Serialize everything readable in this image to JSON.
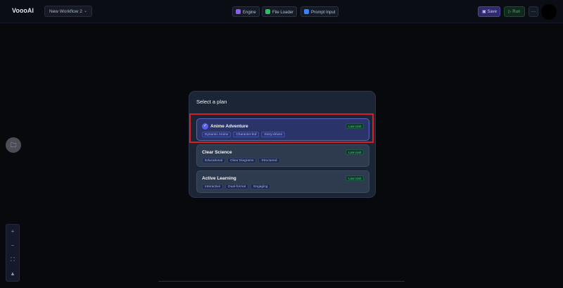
{
  "header": {
    "brand": "VoooAI",
    "workflow_name": "New Workflow 2",
    "tools": [
      {
        "label": "Engine",
        "color": "#8b5cf6"
      },
      {
        "label": "File Loader",
        "color": "#22c55e"
      },
      {
        "label": "Prompt Input",
        "color": "#3b82f6"
      }
    ],
    "save_label": "Save",
    "run_label": "Run",
    "more_label": "…"
  },
  "left_panel": {
    "folder_icon": "folder-icon",
    "zoom_icons": [
      "+",
      "−",
      "⛶",
      "▲"
    ]
  },
  "modal": {
    "title": "Select a plan",
    "plans": [
      {
        "name": "Anime Adventure",
        "cost": "Low cost",
        "selected": true,
        "tags": [
          "Dynamic Anime",
          "Character-led",
          "Story-driven"
        ]
      },
      {
        "name": "Clear Science",
        "cost": "Low cost",
        "selected": false,
        "tags": [
          "Educational",
          "Clear Diagrams",
          "Structured"
        ]
      },
      {
        "name": "Active Learning",
        "cost": "Low cost",
        "selected": false,
        "tags": [
          "Interactive",
          "Dual-format",
          "Engaging"
        ]
      }
    ]
  },
  "colors": {
    "accent": "#5b5ef0",
    "highlight": "#d51f28",
    "cost_badge": "#4bd28f"
  }
}
